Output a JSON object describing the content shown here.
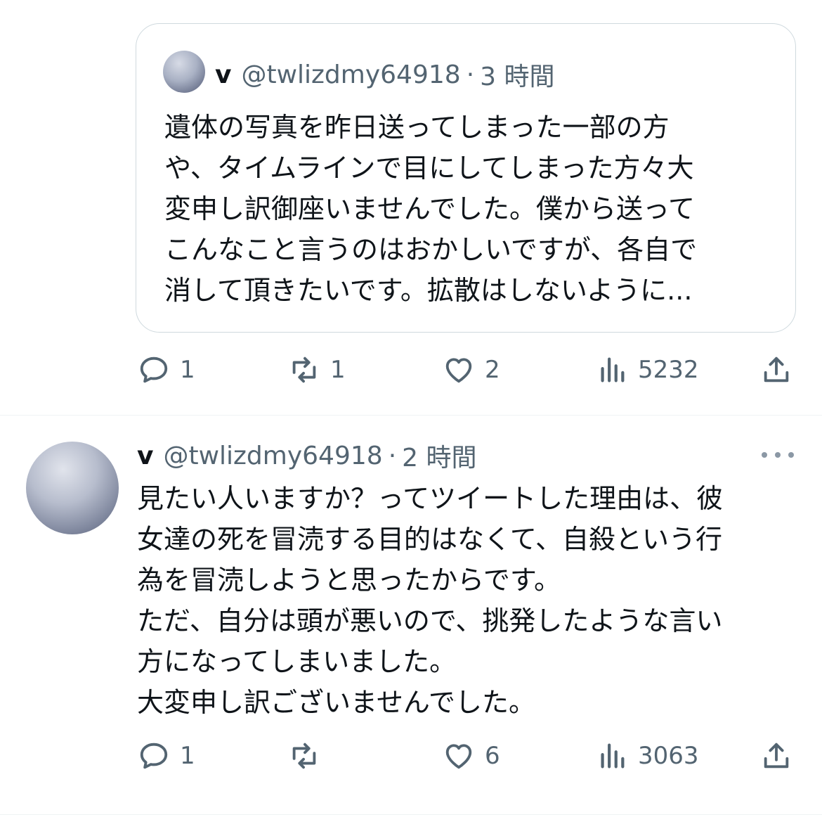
{
  "quote": {
    "display_name": "v",
    "handle": "@twlizdmy64918",
    "separator": "·",
    "time": "3 時間",
    "text": "遺体の写真を昨日送ってしまった一部の方\nや、タイムラインで目にしてしまった方々大\n変申し訳御座いませんでした。僕から送って\nこんなこと言うのはおかしいですが、各自で\n消して頂きたいです。拡散はしないように..."
  },
  "quote_actions": {
    "replies": "1",
    "retweets": "1",
    "likes": "2",
    "views": "5232"
  },
  "tweet": {
    "display_name": "v",
    "handle": "@twlizdmy64918",
    "separator": "·",
    "time": "2 時間",
    "text": "見たい人いますか？ってツイートした理由は、彼\n女達の死を冒涜する目的はなくて、自殺という行\n為を冒涜しようと思ったからです。\nただ、自分は頭が悪いので、挑発したような言い\n方になってしまいました。\n大変申し訳ございませんでした。"
  },
  "tweet_actions": {
    "replies": "1",
    "retweets": "",
    "likes": "6",
    "views": "3063"
  },
  "icons": [
    "reply-icon",
    "retweet-icon",
    "like-icon",
    "views-icon",
    "share-icon",
    "more-icon"
  ],
  "colors": {
    "text": "#0f1419",
    "secondary": "#536471",
    "border": "#cfd9de"
  }
}
